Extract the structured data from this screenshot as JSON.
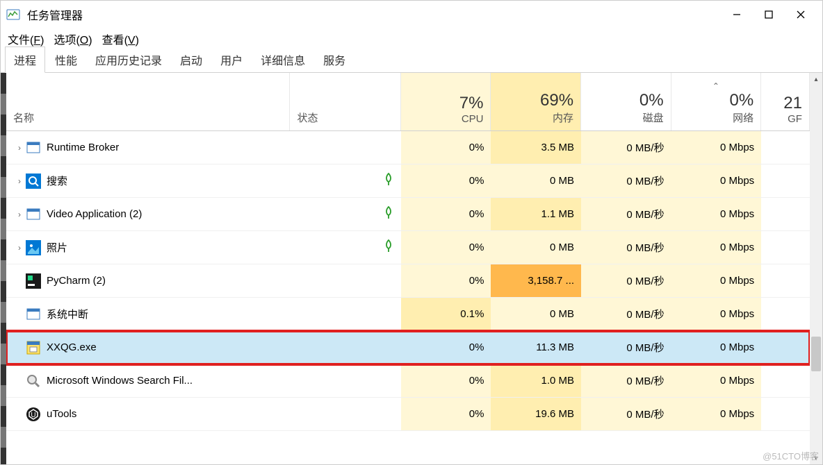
{
  "window": {
    "title": "任务管理器"
  },
  "menubar": [
    {
      "label": "文件",
      "accel": "F"
    },
    {
      "label": "选项",
      "accel": "O"
    },
    {
      "label": "查看",
      "accel": "V"
    }
  ],
  "tabs": [
    {
      "label": "进程",
      "active": true
    },
    {
      "label": "性能"
    },
    {
      "label": "应用历史记录"
    },
    {
      "label": "启动"
    },
    {
      "label": "用户"
    },
    {
      "label": "详细信息"
    },
    {
      "label": "服务"
    }
  ],
  "columns": {
    "name": {
      "label": "名称"
    },
    "status": {
      "label": "状态"
    },
    "cpu": {
      "pct": "7%",
      "label": "CPU"
    },
    "mem": {
      "pct": "69%",
      "label": "内存"
    },
    "disk": {
      "pct": "0%",
      "label": "磁盘"
    },
    "net": {
      "pct": "0%",
      "label": "网络"
    },
    "gpu": {
      "pct": "21",
      "label": "GF"
    }
  },
  "processes": [
    {
      "expand": true,
      "icon": "generic",
      "name": "Runtime Broker",
      "leaf": false,
      "cpu": "0%",
      "mem": "3.5 MB",
      "disk": "0 MB/秒",
      "net": "0 Mbps",
      "heat_cpu": "l",
      "heat_mem": "m"
    },
    {
      "expand": true,
      "icon": "search",
      "name": "搜索",
      "leaf": true,
      "cpu": "0%",
      "mem": "0 MB",
      "disk": "0 MB/秒",
      "net": "0 Mbps",
      "heat_cpu": "l",
      "heat_mem": "l"
    },
    {
      "expand": true,
      "icon": "generic",
      "name": "Video Application (2)",
      "leaf": true,
      "cpu": "0%",
      "mem": "1.1 MB",
      "disk": "0 MB/秒",
      "net": "0 Mbps",
      "heat_cpu": "l",
      "heat_mem": "m"
    },
    {
      "expand": true,
      "icon": "photos",
      "name": "照片",
      "leaf": true,
      "cpu": "0%",
      "mem": "0 MB",
      "disk": "0 MB/秒",
      "net": "0 Mbps",
      "heat_cpu": "l",
      "heat_mem": "l"
    },
    {
      "expand": false,
      "icon": "pycharm",
      "name": "PyCharm (2)",
      "leaf": false,
      "cpu": "0%",
      "mem": "3,158.7 ...",
      "disk": "0 MB/秒",
      "net": "0 Mbps",
      "heat_cpu": "l",
      "heat_mem": "xh"
    },
    {
      "expand": false,
      "icon": "generic",
      "name": "系统中断",
      "leaf": false,
      "cpu": "0.1%",
      "mem": "0 MB",
      "disk": "0 MB/秒",
      "net": "0 Mbps",
      "heat_cpu": "m",
      "heat_mem": "l"
    },
    {
      "expand": false,
      "icon": "exe",
      "name": "XXQG.exe",
      "leaf": false,
      "cpu": "0%",
      "mem": "11.3 MB",
      "disk": "0 MB/秒",
      "net": "0 Mbps",
      "selected": true,
      "highlighted": true
    },
    {
      "expand": false,
      "icon": "search2",
      "name": "Microsoft Windows Search Fil...",
      "leaf": false,
      "cpu": "0%",
      "mem": "1.0 MB",
      "disk": "0 MB/秒",
      "net": "0 Mbps",
      "heat_cpu": "l",
      "heat_mem": "m"
    },
    {
      "expand": false,
      "icon": "utools",
      "name": "uTools",
      "leaf": false,
      "cpu": "0%",
      "mem": "19.6 MB",
      "disk": "0 MB/秒",
      "net": "0 Mbps",
      "heat_cpu": "l",
      "heat_mem": "m"
    }
  ],
  "watermark": "@51CTO博客"
}
